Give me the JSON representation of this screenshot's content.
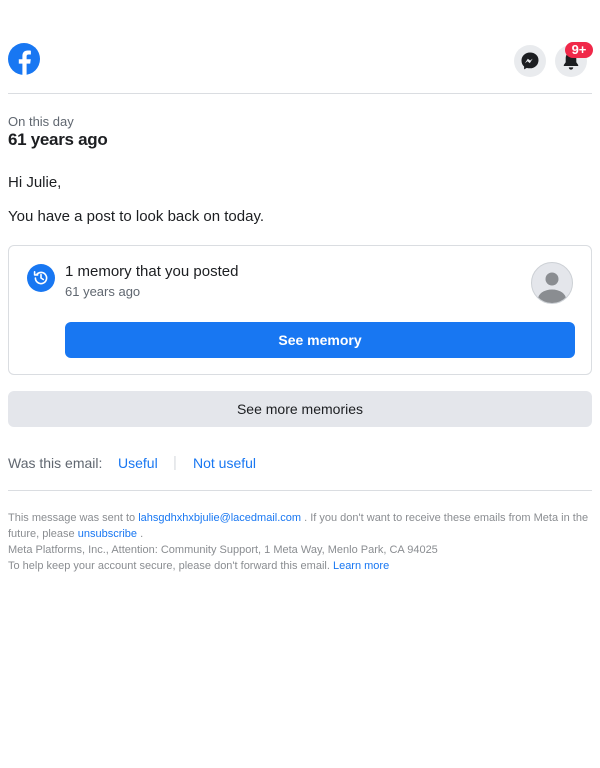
{
  "header": {
    "logo_icon": "facebook-logo-icon",
    "messenger_icon": "messenger-icon",
    "bell_icon": "bell-icon",
    "notification_badge": "9+",
    "badge_color": "#f02849"
  },
  "kicker": "On this day",
  "headline": "61 years ago",
  "greeting": "Hi Julie,",
  "intro": "You have a post to look back on today.",
  "memory_card": {
    "icon": "history-clock-icon",
    "title": "1 memory that you posted",
    "subtitle": "61 years ago",
    "avatar_icon": "default-avatar-icon",
    "button_label": "See memory"
  },
  "see_more_label": "See more memories",
  "feedback": {
    "prompt": "Was this email:",
    "useful": "Useful",
    "separator": "|",
    "not_useful": "Not useful"
  },
  "footer": {
    "sent_prefix": "This message was sent to",
    "email": "lahsgdhxhxbjulie@lacedmail.com",
    "sent_suffix": ". If you don't want to receive these emails from Meta in the future, please",
    "unsubscribe": "unsubscribe",
    "period": ".",
    "address": "Meta Platforms, Inc., Attention: Community Support, 1 Meta Way, Menlo Park, CA 94025",
    "security_note": "To help keep your account secure, please don't forward this email.",
    "learn_more": "Learn more"
  },
  "colors": {
    "accent": "#1877f2",
    "text": "#1c1e21",
    "muted": "#606770",
    "divider": "#dadde1"
  }
}
